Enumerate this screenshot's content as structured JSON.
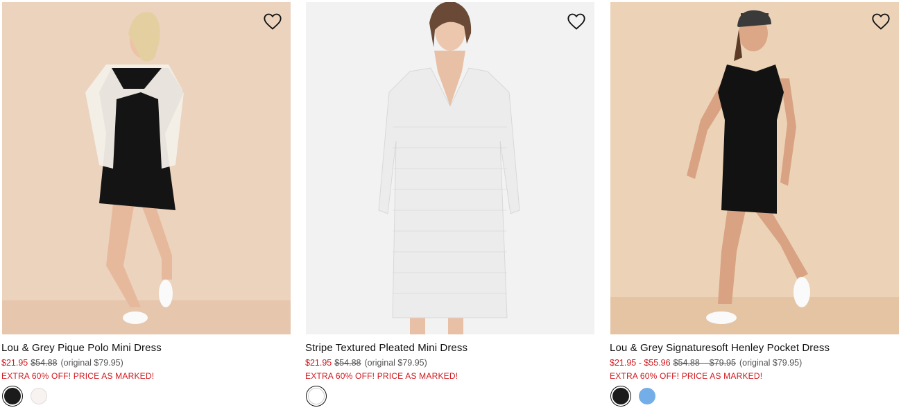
{
  "products": [
    {
      "name": "Lou & Grey Pique Polo Mini Dress",
      "sale_price": "$21.95",
      "list_price": "$54.88",
      "original_note": "(original $79.95)",
      "promo": "EXTRA 60% OFF! PRICE AS MARKED!",
      "image_bg": "#ecd3bd",
      "swatches": [
        {
          "color": "#1b1b1b",
          "selected": true
        },
        {
          "color": "#f8f3f1",
          "selected": false
        }
      ]
    },
    {
      "name": "Stripe Textured Pleated Mini Dress",
      "sale_price": "$21.95",
      "list_price": "$54.88",
      "original_note": "(original $79.95)",
      "promo": "EXTRA 60% OFF! PRICE AS MARKED!",
      "image_bg": "#f2f2f2",
      "swatches": [
        {
          "color": "#ffffff",
          "selected": true
        }
      ]
    },
    {
      "name": "Lou & Grey Signaturesoft Henley Pocket Dress",
      "sale_price": "$21.95 - $55.96",
      "list_price": "$54.88 – $79.95",
      "original_note": "(original $79.95)",
      "promo": "EXTRA 60% OFF! PRICE AS MARKED!",
      "image_bg": "#ecd3b7",
      "swatches": [
        {
          "color": "#1b1b1b",
          "selected": true
        },
        {
          "color": "#74aee8",
          "selected": false
        }
      ]
    }
  ],
  "icons": {
    "favorite": "heart-outline-icon"
  },
  "colors": {
    "sale_red": "#d0191f",
    "text": "#111111",
    "muted": "#555555"
  }
}
